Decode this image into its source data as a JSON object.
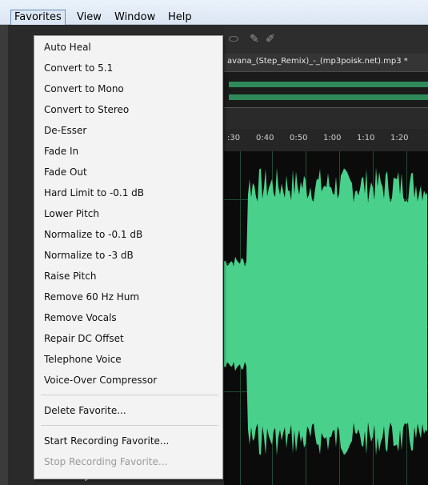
{
  "menubar": {
    "items": [
      "Favorites",
      "View",
      "Window",
      "Help"
    ],
    "active": "Favorites"
  },
  "editor": {
    "tab_title": "avana_(Step_Remix)_-_(mp3poisk.net).mp3 *",
    "ticks": [
      ":30",
      "0:40",
      "0:50",
      "1:00",
      "1:10",
      "1:20"
    ],
    "waveform_color": "#49d18b"
  },
  "favorites_menu": {
    "items": [
      "Auto Heal",
      "Convert to 5.1",
      "Convert to Mono",
      "Convert to Stereo",
      "De-Esser",
      "Fade In",
      "Fade Out",
      "Hard Limit to -0.1 dB",
      "Lower Pitch",
      "Normalize to -0.1 dB",
      "Normalize to -3 dB",
      "Raise Pitch",
      "Remove 60 Hz Hum",
      "Remove Vocals",
      "Repair DC Offset",
      "Telephone Voice",
      "Voice-Over Compressor"
    ],
    "delete_label": "Delete Favorite...",
    "start_recording_label": "Start Recording Favorite...",
    "stop_recording_label": "Stop Recording Favorite..."
  }
}
